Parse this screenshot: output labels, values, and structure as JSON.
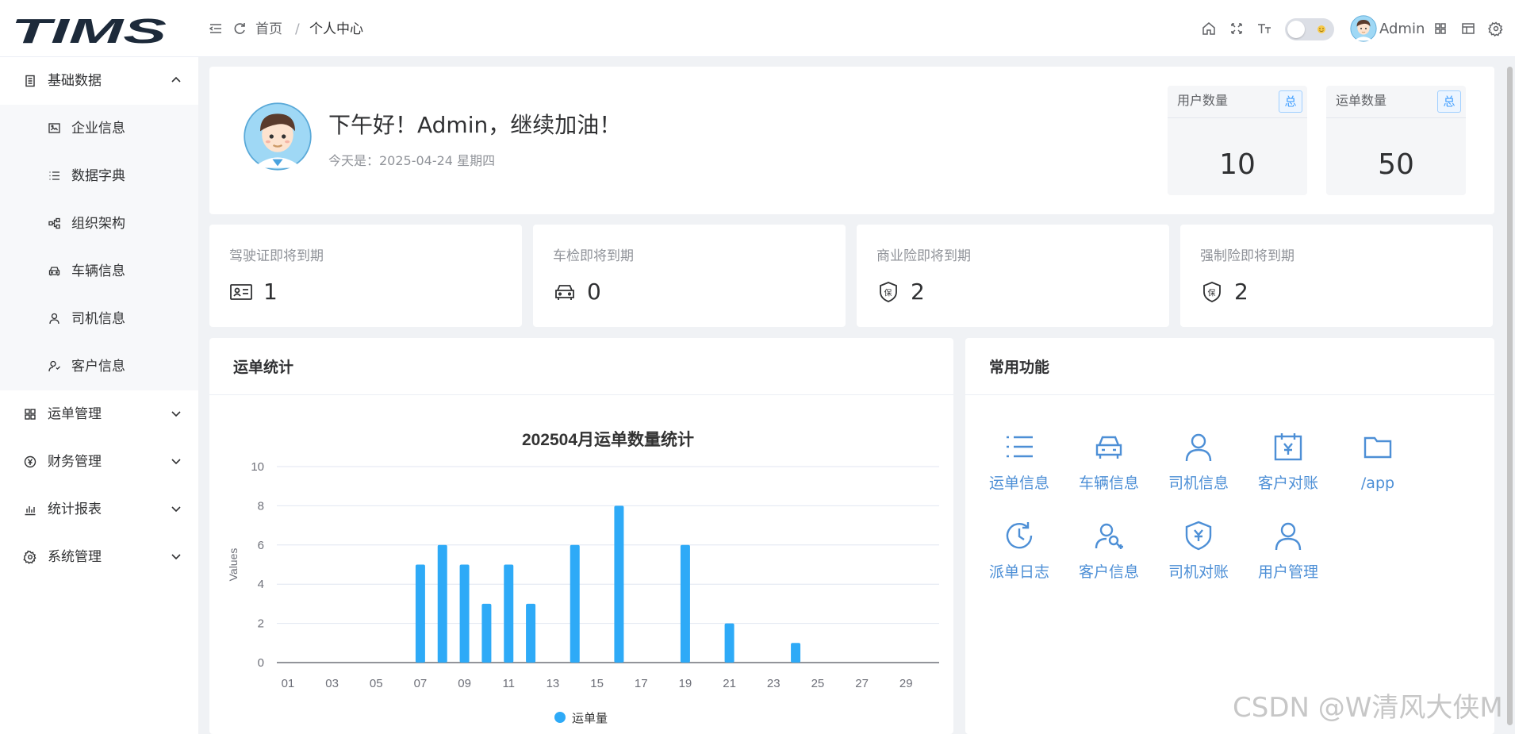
{
  "header": {
    "logo_text": "TIMS",
    "breadcrumb": {
      "home": "首页",
      "separator": "/",
      "current": "个人中心"
    },
    "username": "Admin",
    "icons": [
      "menu-fold-icon",
      "refresh-icon",
      "home-icon",
      "fullscreen-icon",
      "font-size-icon",
      "theme-switch",
      "layout-icon",
      "browser-icon",
      "settings-icon"
    ]
  },
  "sidebar": {
    "groups": [
      {
        "label": "基础数据",
        "icon": "database-icon",
        "expanded": true,
        "children": [
          {
            "label": "企业信息",
            "icon": "company-icon"
          },
          {
            "label": "数据字典",
            "icon": "list-icon"
          },
          {
            "label": "组织架构",
            "icon": "org-chart-icon"
          },
          {
            "label": "车辆信息",
            "icon": "car-icon"
          },
          {
            "label": "司机信息",
            "icon": "user-icon"
          },
          {
            "label": "客户信息",
            "icon": "customer-icon"
          }
        ]
      },
      {
        "label": "运单管理",
        "icon": "grid-icon",
        "expanded": false
      },
      {
        "label": "财务管理",
        "icon": "yen-icon",
        "expanded": false
      },
      {
        "label": "统计报表",
        "icon": "bar-chart-icon",
        "expanded": false
      },
      {
        "label": "系统管理",
        "icon": "gear-icon",
        "expanded": false
      }
    ]
  },
  "welcome": {
    "greeting": "下午好！Admin，继续加油！",
    "date_text": "今天是：2025-04-24 星期四",
    "stats": [
      {
        "title": "用户数量",
        "tag": "总",
        "value": "10"
      },
      {
        "title": "运单数量",
        "tag": "总",
        "value": "50"
      }
    ]
  },
  "alerts": [
    {
      "title": "驾驶证即将到期",
      "icon": "license-icon",
      "value": "1"
    },
    {
      "title": "车检即将到期",
      "icon": "car-icon",
      "value": "0"
    },
    {
      "title": "商业险即将到期",
      "icon": "insurance-shield-icon",
      "value": "2"
    },
    {
      "title": "强制险即将到期",
      "icon": "insurance-shield-icon",
      "value": "2"
    }
  ],
  "chart_panel": {
    "title": "运单统计"
  },
  "chart_data": {
    "type": "bar",
    "title": "202504月运单数量统计",
    "ylabel": "Values",
    "xlabel": "",
    "ylim": [
      0,
      10
    ],
    "yticks": [
      0,
      2,
      4,
      6,
      8,
      10
    ],
    "grid": true,
    "legend_position": "bottom",
    "x_tick_labels": [
      "01",
      "03",
      "05",
      "07",
      "09",
      "11",
      "13",
      "15",
      "17",
      "19",
      "21",
      "23",
      "25",
      "27",
      "29"
    ],
    "categories": [
      "01",
      "02",
      "03",
      "04",
      "05",
      "06",
      "07",
      "08",
      "09",
      "10",
      "11",
      "12",
      "13",
      "14",
      "15",
      "16",
      "17",
      "18",
      "19",
      "20",
      "21",
      "22",
      "23",
      "24",
      "25",
      "26",
      "27",
      "28",
      "29",
      "30"
    ],
    "series": [
      {
        "name": "运单量",
        "color": "#2eaaf7",
        "values": [
          0,
          0,
          0,
          0,
          0,
          0,
          5,
          6,
          5,
          3,
          5,
          3,
          0,
          6,
          0,
          8,
          0,
          0,
          6,
          0,
          2,
          0,
          0,
          1,
          0,
          0,
          0,
          0,
          0,
          0
        ]
      }
    ]
  },
  "functions_panel": {
    "title": "常用功能",
    "items": [
      {
        "label": "运单信息",
        "icon": "list-icon"
      },
      {
        "label": "车辆信息",
        "icon": "car-icon"
      },
      {
        "label": "司机信息",
        "icon": "user-icon"
      },
      {
        "label": "客户对账",
        "icon": "calendar-yen-icon"
      },
      {
        "label": "/app",
        "icon": "folder-icon"
      },
      {
        "label": "派单日志",
        "icon": "clock-history-icon"
      },
      {
        "label": "客户信息",
        "icon": "user-add-icon"
      },
      {
        "label": "司机对账",
        "icon": "shield-yen-icon"
      },
      {
        "label": "用户管理",
        "icon": "user-icon"
      }
    ]
  },
  "colors": {
    "accent": "#409eff",
    "function_blue": "#4d8fd6",
    "bar_blue": "#2eaaf7"
  },
  "watermark": "CSDN @W清风大侠M"
}
